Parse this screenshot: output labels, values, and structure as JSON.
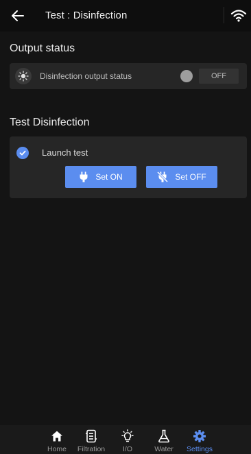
{
  "header": {
    "title": "Test : Disinfection",
    "back_icon": "arrow-left-icon",
    "signal_icon": "wifi-icon"
  },
  "output_status": {
    "section_title": "Output status",
    "row": {
      "icon": "bulb-icon",
      "label": "Disinfection output status",
      "state": "OFF"
    }
  },
  "test_disinfection": {
    "section_title": "Test Disinfection",
    "launch_label": "Launch test",
    "launch_checked": true,
    "set_on_label": "Set ON",
    "set_off_label": "Set OFF"
  },
  "bottom_nav": {
    "items": [
      {
        "label": "Home",
        "icon": "home-icon",
        "active": false
      },
      {
        "label": "Filtration",
        "icon": "filtration-icon",
        "active": false
      },
      {
        "label": "I/O",
        "icon": "lightbulb-icon",
        "active": false
      },
      {
        "label": "Water",
        "icon": "flask-icon",
        "active": false
      },
      {
        "label": "Settings",
        "icon": "gear-icon",
        "active": true
      }
    ]
  },
  "colors": {
    "accent": "#5b8def",
    "background": "#141414",
    "card": "#262626"
  }
}
